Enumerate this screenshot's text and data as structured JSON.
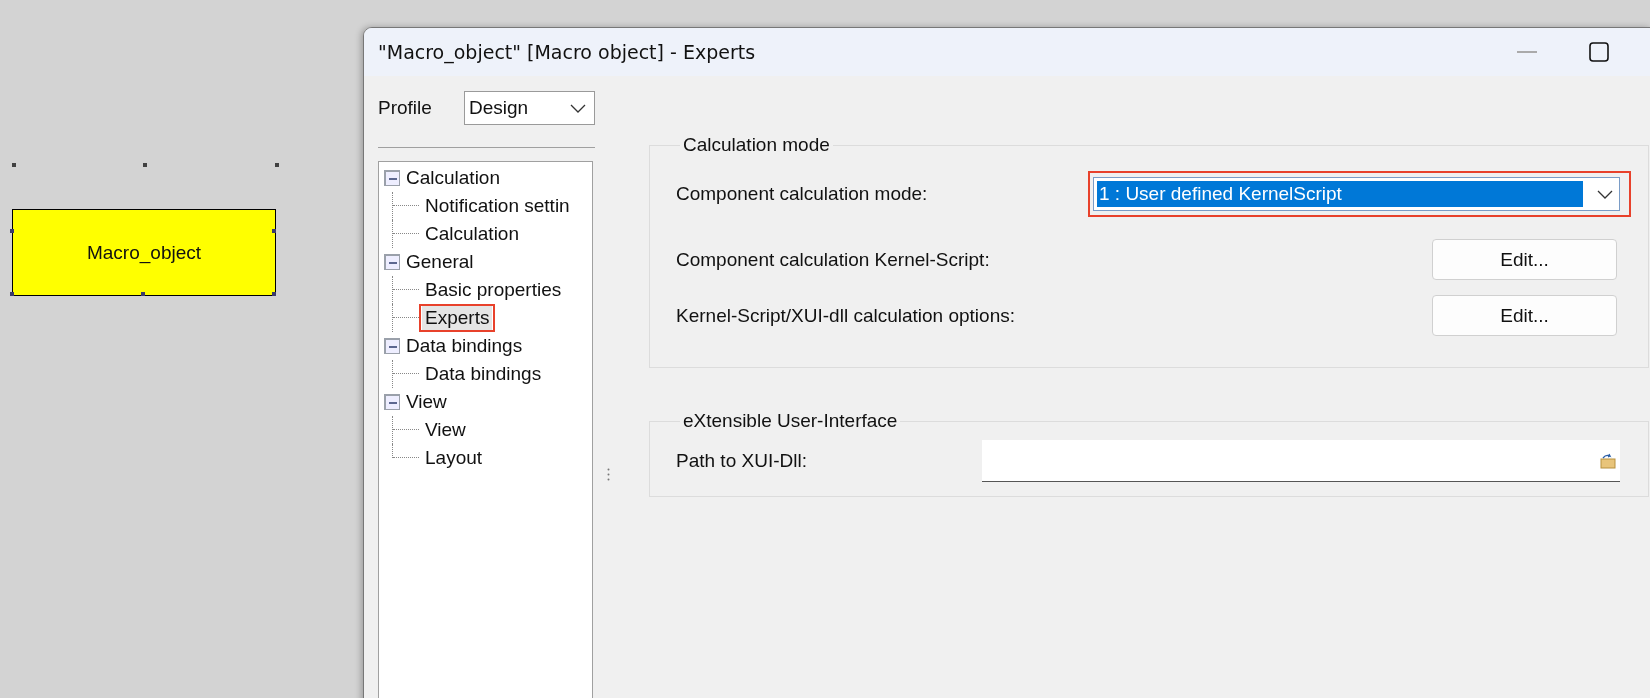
{
  "canvas": {
    "object_label": "Macro_object"
  },
  "window": {
    "title": "\"Macro_object\" [Macro object] - Experts"
  },
  "profile": {
    "label": "Profile",
    "value": "Design"
  },
  "tree": [
    {
      "label": "Calculation",
      "expanded": true,
      "selected": false,
      "children": [
        {
          "label": "Notification settin",
          "selected": false,
          "annotated": false
        },
        {
          "label": "Calculation",
          "selected": false,
          "annotated": false
        }
      ]
    },
    {
      "label": "General",
      "expanded": true,
      "selected": false,
      "children": [
        {
          "label": "Basic properties",
          "selected": false,
          "annotated": false
        },
        {
          "label": "Experts",
          "selected": true,
          "annotated": true
        }
      ]
    },
    {
      "label": "Data bindings",
      "expanded": true,
      "selected": false,
      "children": [
        {
          "label": "Data bindings",
          "selected": false,
          "annotated": false
        }
      ]
    },
    {
      "label": "View",
      "expanded": true,
      "selected": false,
      "children": [
        {
          "label": "View",
          "selected": false,
          "annotated": false
        },
        {
          "label": "Layout",
          "selected": false,
          "annotated": false
        }
      ]
    }
  ],
  "groups": [
    {
      "title": "Calculation mode",
      "rows": [
        {
          "kind": "combo",
          "label": "Component calculation mode:",
          "value": "1 : User defined KernelScript",
          "focused": true,
          "annotated": true
        },
        {
          "kind": "button",
          "label": "Component calculation Kernel-Script:",
          "button": "Edit..."
        },
        {
          "kind": "button",
          "label": "Kernel-Script/XUI-dll calculation options:",
          "button": "Edit..."
        }
      ]
    },
    {
      "title": "eXtensible User-Interface",
      "rows": [
        {
          "kind": "path",
          "label": "Path to XUI-Dll:"
        }
      ]
    }
  ]
}
